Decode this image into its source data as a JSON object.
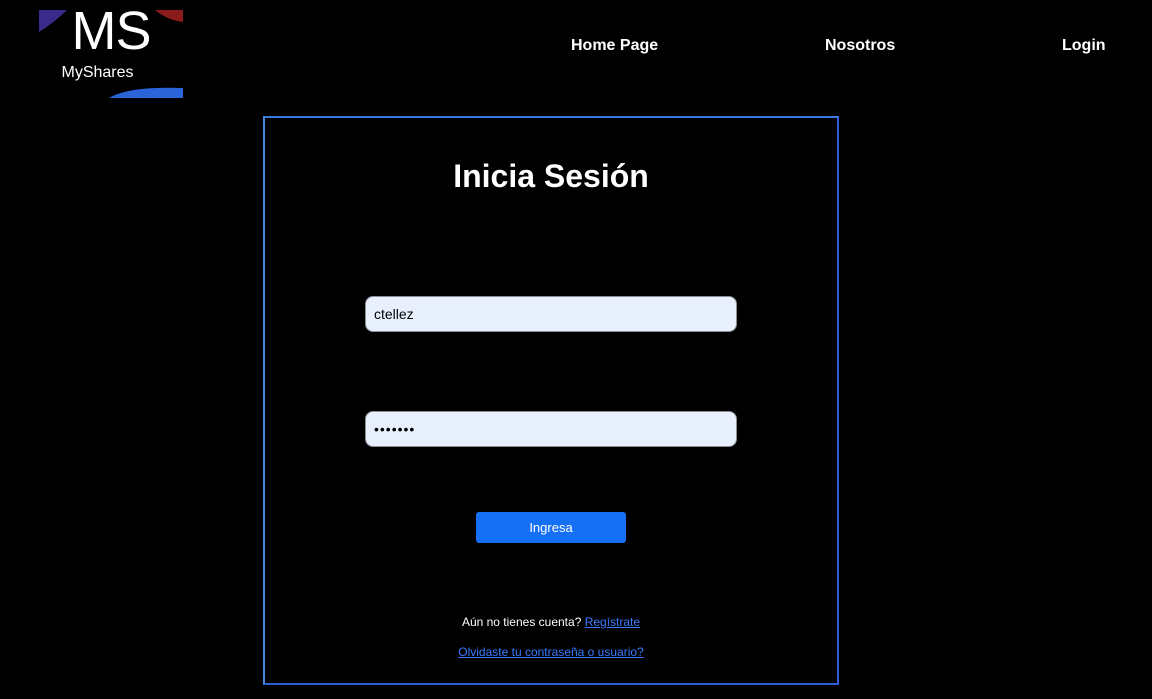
{
  "brand": {
    "mark": "MS",
    "name": "MyShares",
    "colors": {
      "purple": "#3a2a8a",
      "red": "#8b1a1a",
      "blue": "#2b63d9"
    }
  },
  "nav": {
    "items": [
      {
        "label": "Home Page"
      },
      {
        "label": "Nosotros"
      },
      {
        "label": "Login"
      }
    ]
  },
  "login": {
    "title": "Inicia Sesión",
    "username_value": "ctellez",
    "password_value": "•••••••",
    "submit_label": "Ingresa",
    "register_prompt": "Aún no tienes cuenta?",
    "register_link": "Regístrate",
    "forgot_link": "Olvidaste tu contraseña o usuario?"
  },
  "colors": {
    "background": "#000000",
    "card_border": "#2e5fd6",
    "button": "#1670f6",
    "link": "#3b7bff",
    "input_bg": "#e8f0fe"
  }
}
